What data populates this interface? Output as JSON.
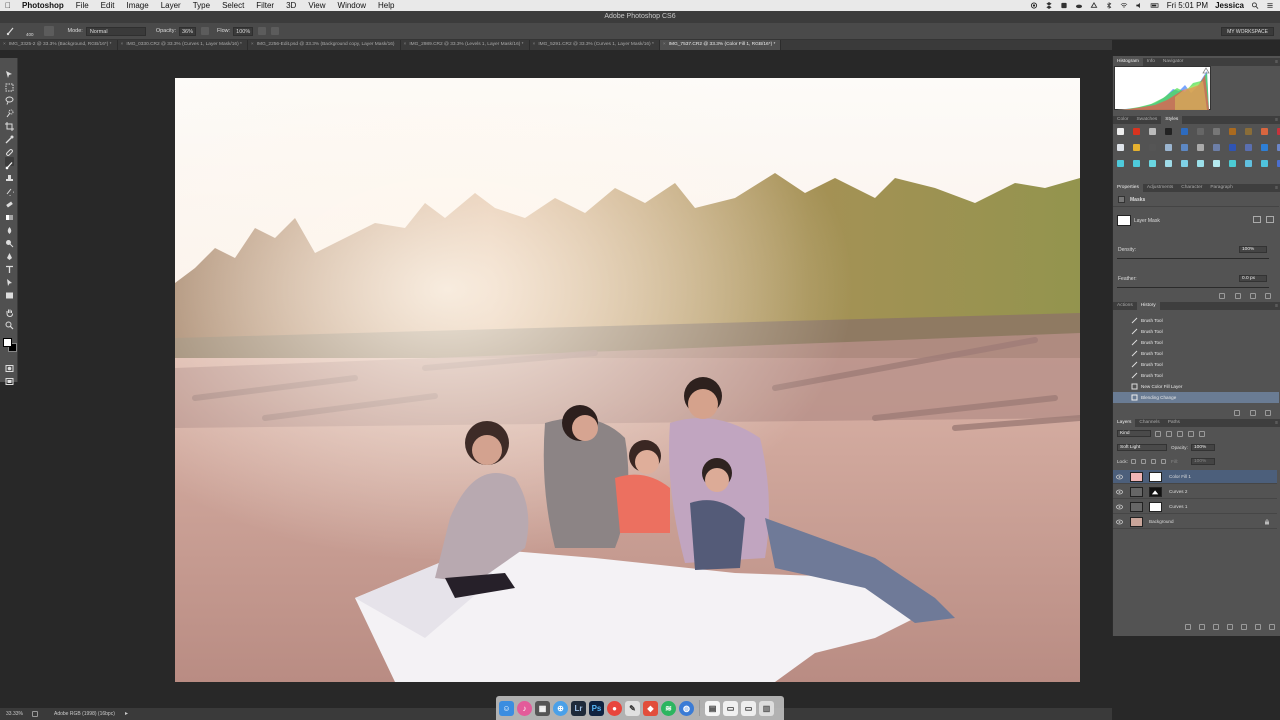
{
  "menubar": {
    "app_name": "Photoshop",
    "items": [
      "File",
      "Edit",
      "Image",
      "Layer",
      "Type",
      "Select",
      "Filter",
      "3D",
      "View",
      "Window",
      "Help"
    ],
    "clock": "Fri 5:01 PM",
    "user": "Jessica"
  },
  "window": {
    "title": "Adobe Photoshop CS6"
  },
  "options_bar": {
    "brush_size": "400",
    "mode_label": "Mode:",
    "mode_value": "Normal",
    "opacity_label": "Opacity:",
    "opacity_value": "36%",
    "flow_label": "Flow:",
    "flow_value": "100%",
    "workspace": "MY WORKSPACE"
  },
  "doc_tabs": [
    "IMG_3325-2 @ 33.3% (Background, RGB/16*) *",
    "IMG_0330.CR2 @ 33.3% (Curves 1, Layer Mask/16) *",
    "IMG_2256-Edit.psd @ 33.3% (Background copy, Layer Mask/16)",
    "IMG_2989.CR2 @ 33.3% (Levels 1, Layer Mask/16) *",
    "IMG_5291.CR2 @ 33.3% (Curves 1, Layer Mask/16) *",
    "IMG_7537.CR2 @ 33.3% (Color Fill 1, RGB/16*) *"
  ],
  "status_bar": {
    "zoom": "33.33%",
    "profile": "Adobe RGB (1998) (16bpc)"
  },
  "panels": {
    "histogram_tabs": [
      "Histogram",
      "Info",
      "Navigator"
    ],
    "swatch_tabs": [
      "Color",
      "Swatches",
      "Styles"
    ],
    "properties_tabs": [
      "Properties",
      "Adjustments",
      "Character",
      "Paragraph"
    ],
    "properties": {
      "section": "Masks",
      "mask_label": "Layer Mask",
      "density_label": "Density:",
      "density_value": "100%",
      "feather_label": "Feather:",
      "feather_value": "0.0 px"
    },
    "history_tabs": [
      "Actions",
      "History"
    ],
    "history": [
      "Brush Tool",
      "Brush Tool",
      "Brush Tool",
      "Brush Tool",
      "Brush Tool",
      "Brush Tool",
      "New Color Fill Layer",
      "Blending Change"
    ],
    "layers_tabs": [
      "Layers",
      "Channels",
      "Paths"
    ],
    "layers_filter": "Kind",
    "blend_mode": "Soft Light",
    "layer_opacity_label": "Opacity:",
    "layer_opacity_value": "100%",
    "lock_label": "Lock:",
    "fill_label": "Fill:",
    "fill_value": "100%",
    "layers": [
      "Color Fill 1",
      "Curves 2",
      "Curves 1",
      "Background"
    ]
  },
  "colors": {
    "fill_layer_thumb": "#f0b5b5",
    "selection": "#4c5f7b",
    "history_selection": "#6a7c94"
  }
}
